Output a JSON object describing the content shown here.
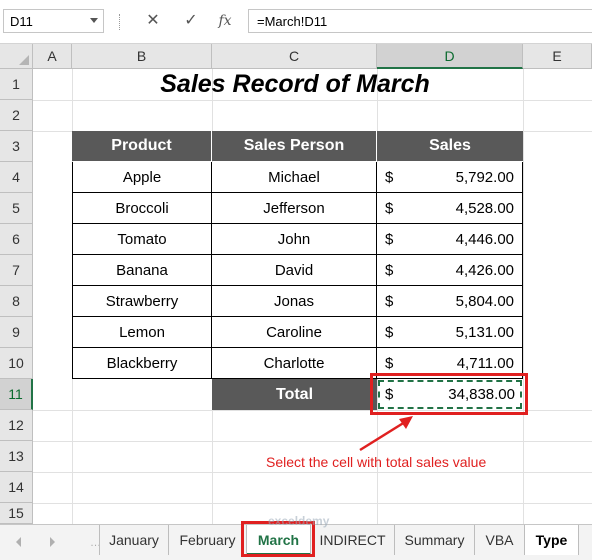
{
  "formula_bar": {
    "name_box": "D11",
    "cancel_icon": "✕",
    "enter_icon": "✓",
    "fx_label": "fx",
    "formula": "=March!D11"
  },
  "columns": [
    "A",
    "B",
    "C",
    "D",
    "E"
  ],
  "rows": [
    "1",
    "2",
    "3",
    "4",
    "5",
    "6",
    "7",
    "8",
    "9",
    "10",
    "11",
    "12",
    "13",
    "14",
    "15"
  ],
  "title": "Sales Record of March",
  "table": {
    "headers": [
      "Product",
      "Sales Person",
      "Sales"
    ],
    "currency_symbol": "$",
    "rows": [
      {
        "product": "Apple",
        "person": "Michael",
        "sales": "5,792.00"
      },
      {
        "product": "Broccoli",
        "person": "Jefferson",
        "sales": "4,528.00"
      },
      {
        "product": "Tomato",
        "person": "John",
        "sales": "4,446.00"
      },
      {
        "product": "Banana",
        "person": "David",
        "sales": "4,426.00"
      },
      {
        "product": "Strawberry",
        "person": "Jonas",
        "sales": "5,804.00"
      },
      {
        "product": "Lemon",
        "person": "Caroline",
        "sales": "5,131.00"
      },
      {
        "product": "Blackberry",
        "person": "Charlotte",
        "sales": "4,711.00"
      }
    ],
    "total_label": "Total",
    "total_value": "34,838.00"
  },
  "annotation": "Select the cell with total sales value",
  "watermark": "exceldemy",
  "tabs": [
    "January",
    "February",
    "March",
    "INDIRECT",
    "Summary",
    "VBA",
    "Type"
  ],
  "colors": {
    "header_fill": "#595959",
    "excel_green": "#217346",
    "annotation_red": "#e02020"
  }
}
